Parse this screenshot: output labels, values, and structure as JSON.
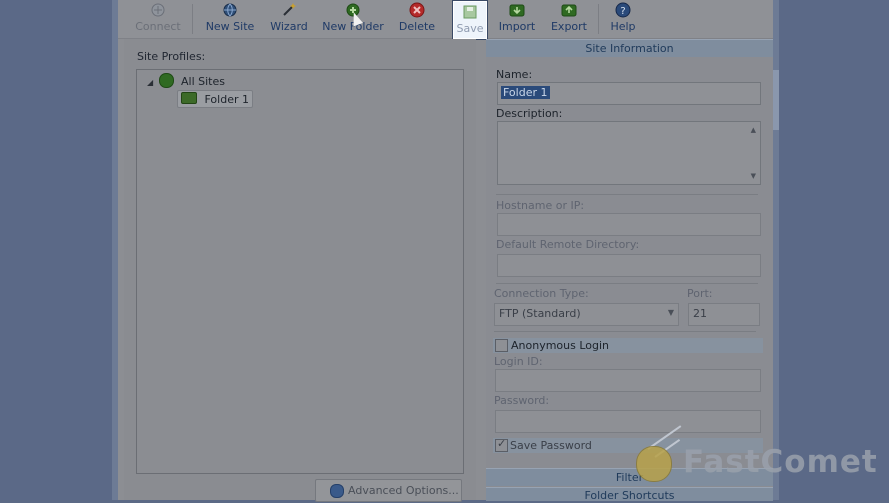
{
  "toolbar": {
    "connect": "Connect",
    "new_site": "New Site",
    "wizard": "Wizard",
    "new_folder": "New Folder",
    "delete": "Delete",
    "save": "Save",
    "import": "Import",
    "export": "Export",
    "help": "Help"
  },
  "left": {
    "site_profiles_label": "Site Profiles:",
    "tree": {
      "root": "All Sites",
      "child": "Folder 1"
    },
    "advanced_button": "Advanced Options..."
  },
  "right": {
    "site_info_header": "Site Information",
    "name_label": "Name:",
    "name_value": "Folder 1",
    "description_label": "Description:",
    "hostname_label": "Hostname or IP:",
    "remote_dir_label": "Default Remote Directory:",
    "connection_type_label": "Connection Type:",
    "connection_type_value": "FTP (Standard)",
    "port_label": "Port:",
    "port_value": "21",
    "anonymous_login": "Anonymous Login",
    "login_id_label": "Login ID:",
    "password_label": "Password:",
    "save_password": "Save Password",
    "filter_header": "Filter",
    "folder_shortcuts_header": "Folder Shortcuts"
  },
  "watermark": {
    "text": "FastComet"
  },
  "colors": {
    "accent": "#2a4a7a",
    "delete_red": "#b52a2a",
    "green": "#2f6a22"
  }
}
